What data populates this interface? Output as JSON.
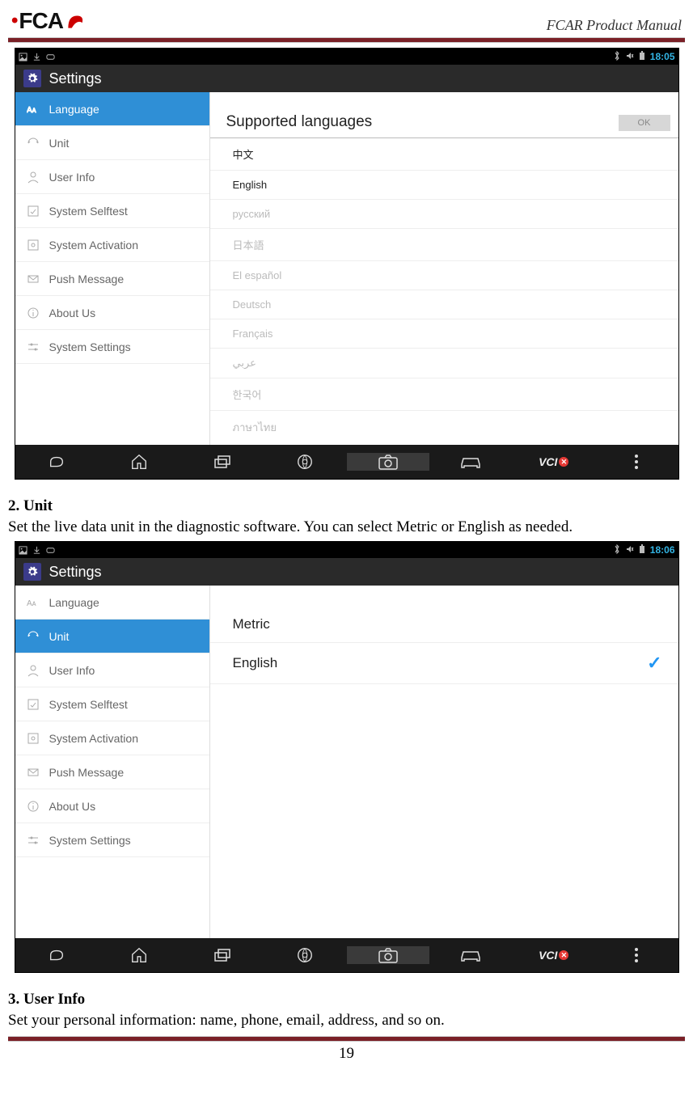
{
  "docHeader": {
    "logoText": "FCAR",
    "title": "FCAR Product Manual"
  },
  "shot1": {
    "clock": "18:05",
    "title": "Settings",
    "sidebar": {
      "language": "Language",
      "unit": "Unit",
      "userInfo": "User Info",
      "selftest": "System Selftest",
      "activation": "System Activation",
      "push": "Push Message",
      "about": "About Us",
      "settings": "System Settings"
    },
    "mainTitle": "Supported languages",
    "okLabel": "OK",
    "langs": {
      "zh": "中文",
      "en": "English",
      "ru": "русский",
      "ja": "日本語",
      "es": "El español",
      "de": "Deutsch",
      "fr": "Français",
      "ar": "عربي",
      "ko": "한국어",
      "th": "ภาษาไทย"
    },
    "navVci": "VCI"
  },
  "section2": {
    "title": "2. Unit",
    "text": "Set the live data unit in the diagnostic software. You can select Metric or English as needed."
  },
  "shot2": {
    "clock": "18:06",
    "title": "Settings",
    "sidebar": {
      "language": "Language",
      "unit": "Unit",
      "userInfo": "User Info",
      "selftest": "System Selftest",
      "activation": "System Activation",
      "push": "Push Message",
      "about": "About Us",
      "settings": "System Settings"
    },
    "units": {
      "metric": "Metric",
      "english": "English"
    },
    "navVci": "VCI"
  },
  "section3": {
    "title": "3. User Info",
    "text": "Set your personal information: name, phone, email, address, and so on."
  },
  "footer": {
    "pageNumber": "19"
  }
}
